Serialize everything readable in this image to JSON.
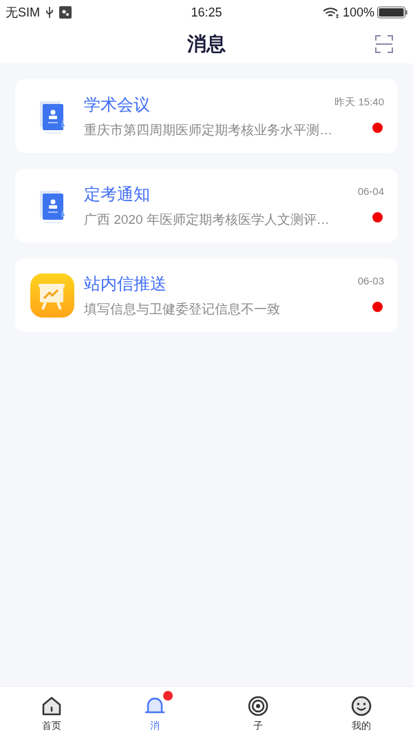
{
  "status_bar": {
    "carrier": "无SIM",
    "time": "16:25",
    "battery": "100%"
  },
  "header": {
    "title": "消息"
  },
  "messages": [
    {
      "kind": "doc",
      "title": "学术会议",
      "preview": "重庆市第四周期医师定期考核业务水平测…",
      "time": "昨天 15:40",
      "unread": true
    },
    {
      "kind": "doc",
      "title": "定考通知",
      "preview": "广西 2020 年医师定期考核医学人文测评…",
      "time": "06-04",
      "unread": true
    },
    {
      "kind": "app",
      "title": "站内信推送",
      "preview": "填写信息与卫健委登记信息不一致",
      "time": "06-03",
      "unread": true
    }
  ],
  "tab_bar": [
    {
      "kind": "home",
      "label": "首页",
      "selected": false,
      "badge": false
    },
    {
      "kind": "bell",
      "label": "消",
      "selected": true,
      "badge": true
    },
    {
      "kind": "target",
      "label": "子",
      "selected": false,
      "badge": false
    },
    {
      "kind": "smile",
      "label": "我的",
      "selected": false,
      "badge": false
    }
  ]
}
